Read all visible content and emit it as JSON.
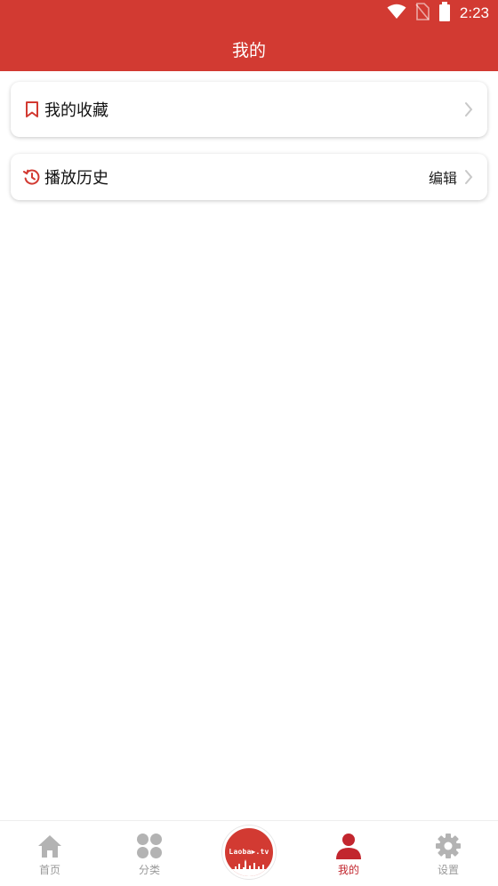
{
  "status_bar": {
    "time": "2:23",
    "icons": [
      "wifi-icon",
      "no-sim-icon",
      "battery-icon"
    ]
  },
  "header": {
    "title": "我的"
  },
  "cards": {
    "favorites": {
      "label": "我的收藏",
      "icon": "bookmark-icon"
    },
    "history": {
      "label": "播放历史",
      "icon": "history-icon",
      "action": "编辑"
    }
  },
  "bottom_nav": {
    "items": [
      {
        "label": "首页",
        "icon": "home-icon",
        "active": false
      },
      {
        "label": "分类",
        "icon": "category-icon",
        "active": false
      },
      {
        "label": "",
        "icon": "app-logo",
        "logo_text": "Laoba▶.tv"
      },
      {
        "label": "我的",
        "icon": "user-icon",
        "active": true
      },
      {
        "label": "设置",
        "icon": "gear-icon",
        "active": false
      }
    ]
  },
  "colors": {
    "brand": "#d23a32",
    "active": "#c2262e",
    "inactive": "#9a9a9a",
    "chevron": "#c8c8c8"
  }
}
